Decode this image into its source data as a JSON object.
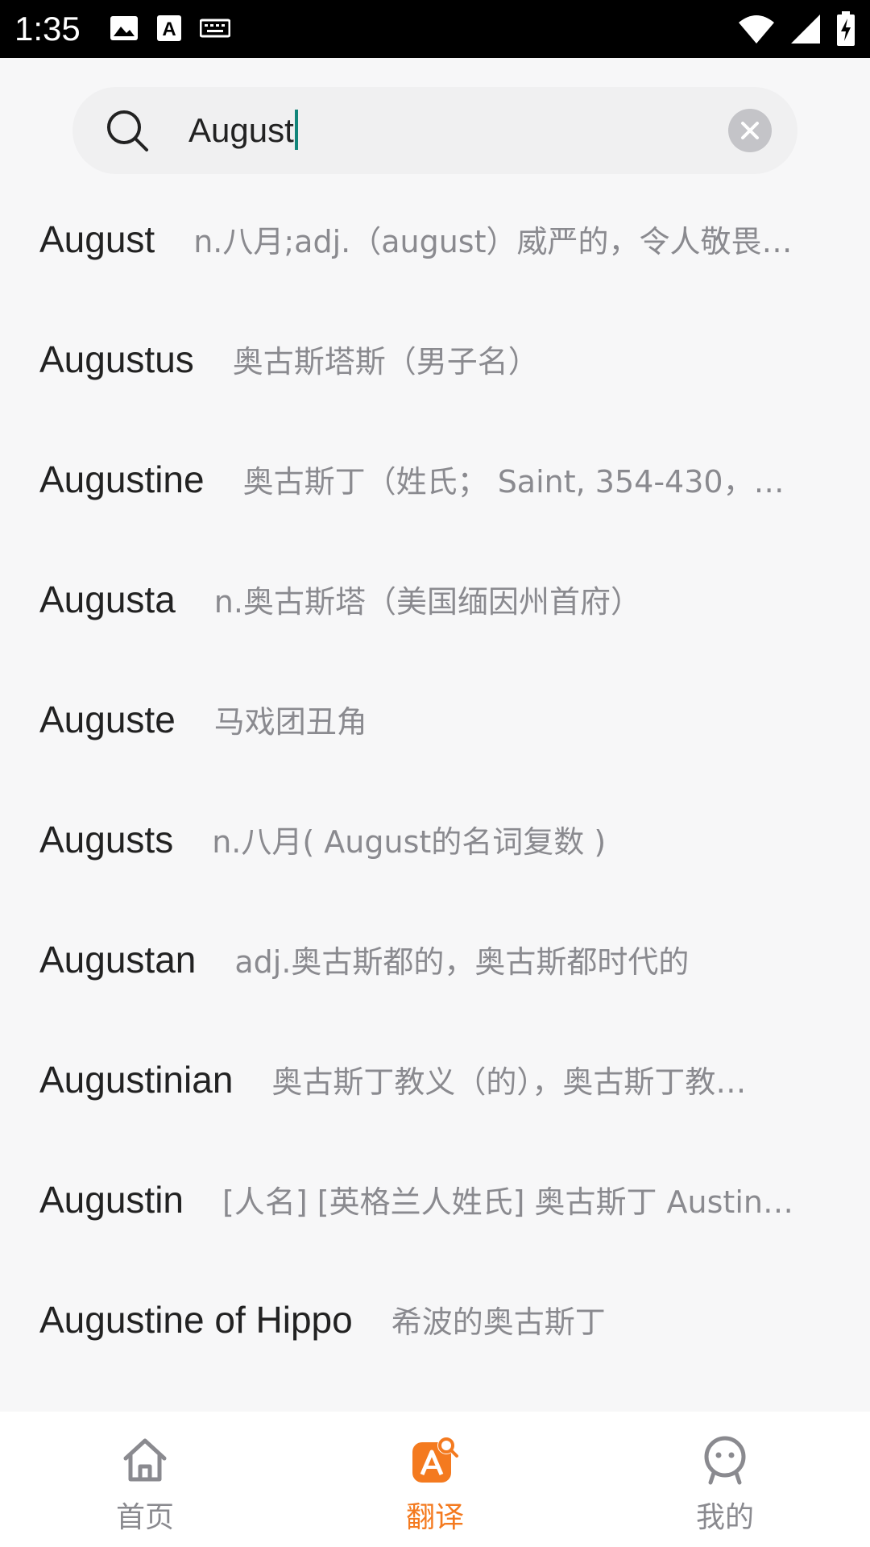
{
  "status_bar": {
    "time": "1:35",
    "icons_left": [
      "image-icon",
      "text-a-icon",
      "keyboard-icon"
    ],
    "icons_right": [
      "wifi-icon",
      "signal-icon",
      "battery-charging-icon"
    ]
  },
  "search": {
    "value": "August",
    "caret_color": "#12857a"
  },
  "results": [
    {
      "word": "August",
      "definition": "n.八月;adj.（august）威严的，令人敬畏…"
    },
    {
      "word": "Augustus",
      "definition": "奥古斯塔斯（男子名）"
    },
    {
      "word": "Augustine",
      "definition": "奥古斯丁（姓氏； Saint, 354-430，…"
    },
    {
      "word": "Augusta",
      "definition": "n.奥古斯塔（美国缅因州首府）"
    },
    {
      "word": "Auguste",
      "definition": "马戏团丑角"
    },
    {
      "word": "Augusts",
      "definition": "n.八月( August的名词复数 )"
    },
    {
      "word": "Augustan",
      "definition": "adj.奥古斯都的，奥古斯都时代的"
    },
    {
      "word": "Augustinian",
      "definition": "奥古斯丁教义（的），奥古斯丁教…"
    },
    {
      "word": "Augustin",
      "definition": "[人名] [英格兰人姓氏] 奥古斯丁 Austin…"
    },
    {
      "word": "Augustine of Hippo",
      "definition": "希波的奥古斯丁"
    }
  ],
  "bottom_nav": {
    "items": [
      {
        "label": "首页",
        "icon": "home-icon",
        "active": false
      },
      {
        "label": "翻译",
        "icon": "translate-icon",
        "active": true
      },
      {
        "label": "我的",
        "icon": "profile-icon",
        "active": false
      }
    ],
    "active_color": "#f47a1f",
    "inactive_color": "#8a8a8f"
  }
}
